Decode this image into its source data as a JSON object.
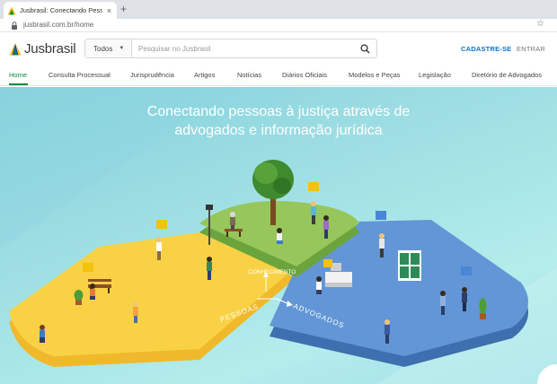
{
  "browser": {
    "tab_title": "Jusbrasil: Conectando Pessoas à",
    "tab_close": "×",
    "url": "jusbrasil.com.br/home"
  },
  "header": {
    "logo_text": "Jusbrasil",
    "search_category": "Todos",
    "search_placeholder": "Pesquisar no Jusbrasil",
    "signup": "CADASTRE-SE",
    "login": "ENTRAR"
  },
  "nav": {
    "items": [
      "Home",
      "Consulta Processual",
      "Jurisprudência",
      "Artigos",
      "Notícias",
      "Diários Oficiais",
      "Modelos e Peças",
      "Legislação",
      "Diretório de Advogados"
    ]
  },
  "hero": {
    "title_line1": "Conectando pessoas à justiça através de",
    "title_line2": "advogados e informação jurídica",
    "label_knowledge": "CONHECIMENTO",
    "label_people": "PESSOAS",
    "label_lawyers": "ADVOGADOS"
  },
  "colors": {
    "brand_green": "#0a8a3a",
    "link_blue": "#0a74c9",
    "path_yellow": "#f7cf3a",
    "path_blue": "#5a8fcf",
    "island_green": "#8fc35a"
  }
}
